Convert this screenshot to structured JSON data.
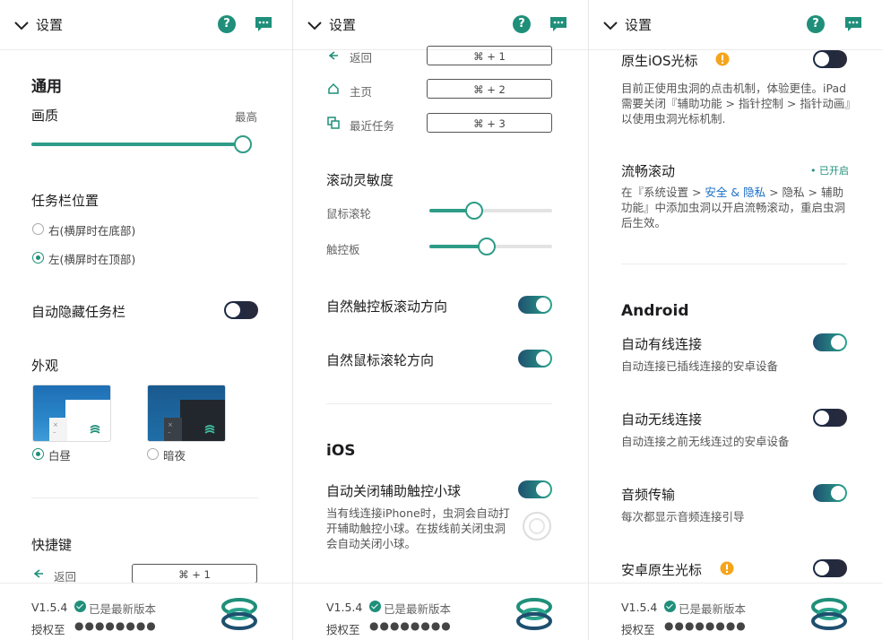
{
  "header": {
    "title": "设置"
  },
  "footer": {
    "version": "V1.5.4",
    "status": "已是最新版本",
    "license_label": "授权至",
    "license_value": "●●●●●●●●"
  },
  "panel1": {
    "general_title": "通用",
    "quality_label": "画质",
    "quality_value": "最高",
    "quality_level": 1.0,
    "taskbar_title": "任务栏位置",
    "taskbar_options": [
      "右(横屏时在底部)",
      "左(横屏时在顶部)"
    ],
    "taskbar_selected": 1,
    "autohide_label": "自动隐藏任务栏",
    "autohide_on": false,
    "appearance_title": "外观",
    "appearance_options": [
      "白昼",
      "暗夜"
    ],
    "appearance_selected": 0,
    "shortcuts_title": "快捷键",
    "shortcut_back_label": "返回",
    "shortcut_back_key": "⌘ + 1"
  },
  "panel2": {
    "shortcuts": [
      {
        "label": "返回",
        "key": "⌘ + 1",
        "icon": "back-icon"
      },
      {
        "label": "主页",
        "key": "⌘ + 2",
        "icon": "home-icon"
      },
      {
        "label": "最近任务",
        "key": "⌘ + 3",
        "icon": "recent-tasks-icon"
      }
    ],
    "scroll_title": "滚动灵敏度",
    "mouse_wheel_label": "鼠标滚轮",
    "mouse_wheel_level": 0.36,
    "touchpad_label": "触控板",
    "touchpad_level": 0.46,
    "natural_touchpad_label": "自然触控板滚动方向",
    "natural_mouse_label": "自然鼠标滚轮方向",
    "ios_title": "iOS",
    "assistive_label": "自动关闭辅助触控小球",
    "assistive_desc": "当有线连接iPhone时，虫洞会自动打开辅助触控小球。在拔线前关闭虫洞会自动关闭小球。"
  },
  "panel3": {
    "native_ios_cursor_label": "原生iOS光标",
    "native_ios_cursor_desc": "目前正使用虫洞的点击机制，体验更佳。iPad需要关闭『辅助功能 > 指针控制 > 指针动画』以使用虫洞光标机制.",
    "smooth_scroll_label": "流畅滚动",
    "smooth_scroll_status": "• 已开启",
    "smooth_desc_part1": "在『系统设置 > ",
    "smooth_desc_link": "安全 & 隐私",
    "smooth_desc_part2": " > 隐私 > 辅助功能』中添加虫洞以开启流畅滚动，重启虫洞后生效。",
    "android_title": "Android",
    "wired_label": "自动有线连接",
    "wired_desc": "自动连接已插线连接的安卓设备",
    "wireless_label": "自动无线连接",
    "wireless_desc": "自动连接之前无线连过的安卓设备",
    "audio_label": "音频传输",
    "audio_desc": "每次都显示音频连接引导",
    "android_cursor_label": "安卓原生光标"
  },
  "colors": {
    "accent": "#1f8f7a",
    "link": "#1a6fc4",
    "warning": "#f4a51c"
  }
}
